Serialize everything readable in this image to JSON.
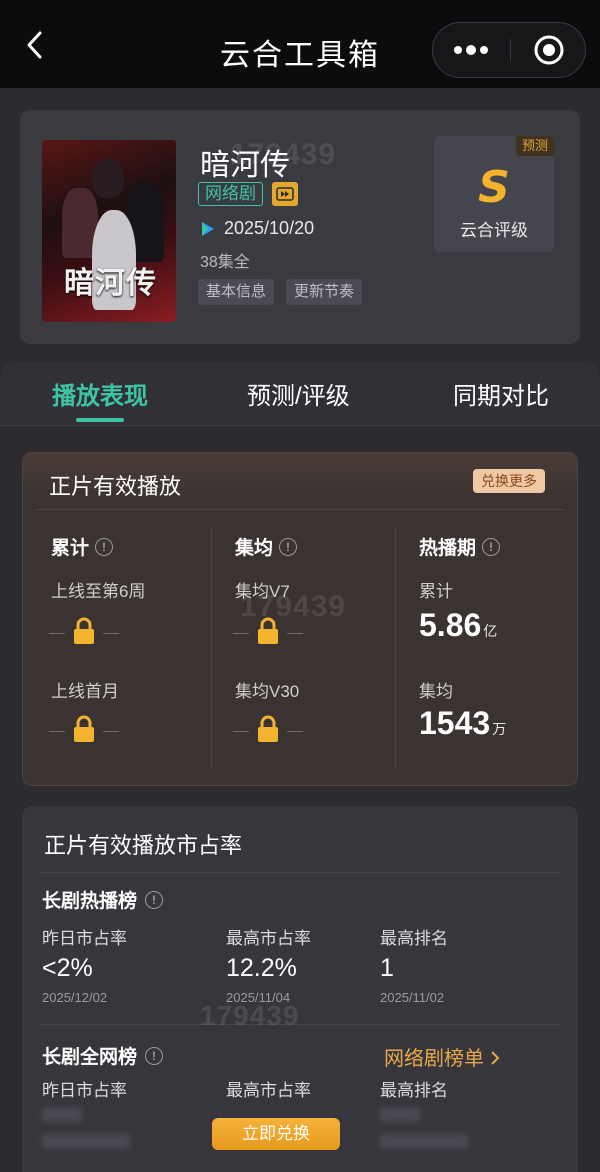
{
  "topbar": {
    "title": "云合工具箱"
  },
  "drama": {
    "title": "暗河传",
    "tag": "网络剧",
    "release_date": "2025/10/20",
    "episodes": "38集全",
    "buttons": [
      "基本信息",
      "更新节奏"
    ],
    "poster_title": "暗河传",
    "rating": {
      "badge": "预测",
      "grade": "S",
      "label": "云合评级"
    }
  },
  "watermark": "179439",
  "tabs": [
    "播放表现",
    "预测/评级",
    "同期对比"
  ],
  "play": {
    "title": "正片有效播放",
    "redeem_badge": "兑换更多",
    "col1": {
      "head": "累计",
      "items": [
        "上线至第6周",
        "上线首月"
      ]
    },
    "col2": {
      "head": "集均",
      "items": [
        "集均V7",
        "集均V30"
      ]
    },
    "col3": {
      "head": "热播期",
      "total_label": "累计",
      "total_value": "5.86",
      "total_unit": "亿",
      "avg_label": "集均",
      "avg_value": "1543",
      "avg_unit": "万"
    }
  },
  "share": {
    "title": "正片有效播放市占率",
    "sec1": {
      "title": "长剧热播榜",
      "labels": [
        "昨日市占率",
        "最高市占率",
        "最高排名"
      ],
      "values": [
        "<2%",
        "12.2%",
        "1"
      ],
      "dates": [
        "2025/12/02",
        "2025/11/04",
        "2025/11/02"
      ]
    },
    "sec2": {
      "title": "长剧全网榜",
      "link": "网络剧榜单",
      "labels": [
        "昨日市占率",
        "最高市占率",
        "最高排名"
      ]
    },
    "redeem_button": "立即兑换"
  }
}
